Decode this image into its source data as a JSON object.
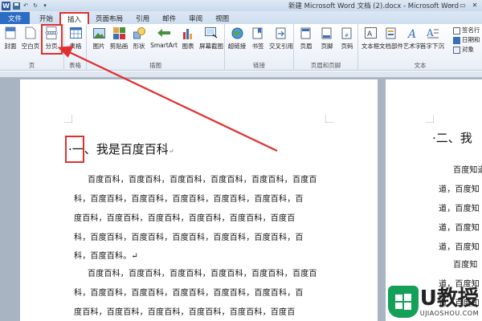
{
  "window": {
    "title": "新建 Microsoft Word 文档 (2).docx - Microsoft Word",
    "app_icon": "W",
    "controls": {
      "minimize": "–",
      "restore": "▭",
      "close": "✕"
    }
  },
  "tabs": [
    {
      "label": "文件"
    },
    {
      "label": "开始"
    },
    {
      "label": "插入"
    },
    {
      "label": "页面布局"
    },
    {
      "label": "引用"
    },
    {
      "label": "邮件"
    },
    {
      "label": "审阅"
    },
    {
      "label": "视图"
    }
  ],
  "ribbon": {
    "groups": {
      "pages": "页",
      "tables": "表格",
      "illustrations": "插图",
      "links": "链接",
      "header_footer": "页眉和页脚",
      "text": "文本"
    },
    "buttons": {
      "cover": "封面",
      "blank_page": "空白页",
      "page_break": "分页",
      "table": "表格",
      "picture": "图片",
      "clipart": "剪贴画",
      "shapes": "形状",
      "smartart": "SmartArt",
      "chart": "图表",
      "screenshot": "屏幕截图",
      "hyperlink": "超链接",
      "bookmark": "书签",
      "cross_ref": "交叉引用",
      "header": "页眉",
      "footer": "页脚",
      "page_number": "页码",
      "textbox": "文本框",
      "quick_parts": "文档部件",
      "wordart": "艺术字",
      "dropcap": "首字下沉"
    },
    "side": {
      "signature": "签名行",
      "datetime": "日期和",
      "object": "对象"
    }
  },
  "document": {
    "page1": {
      "heading_marker": "·",
      "heading": "一、我是百度百科",
      "heading_return": "↵",
      "lines": [
        "百度百科，百度百科，百度百科，百度百科，百度百科，百度百",
        "科，百度百科，百度百科，百度百科，百度百科，百度百科，百",
        "度百科，百度百科，百度百科，百度百科，百度百科，百度百",
        "科，百度百科，百度百科，百度百科，百度百科，百度百科，百",
        "科，百度百科。↵",
        "百度百科，百度百科，百度百科，百度百科，百度百科，百度百",
        "科，百度百科，百度百科，百度百科，百度百科，百度百科，百",
        "度百科，百度百科，百度百科，百度百科，百度百科，百度百"
      ]
    },
    "page2": {
      "heading": "·二、我",
      "lines": [
        "百度知道",
        "道，百度知",
        "道，百度知",
        "道，百度知",
        "道，百度知",
        "百度知",
        "道，百度知",
        "道，百度知"
      ]
    }
  },
  "watermark": {
    "big": "U教授",
    "small": "UJIAOSHOU.COM"
  },
  "colors": {
    "annotation": "#e03030",
    "file_tab": "#2b6cc4",
    "workspace": "#a9b4c2",
    "watermark_green": "#15a05a"
  }
}
